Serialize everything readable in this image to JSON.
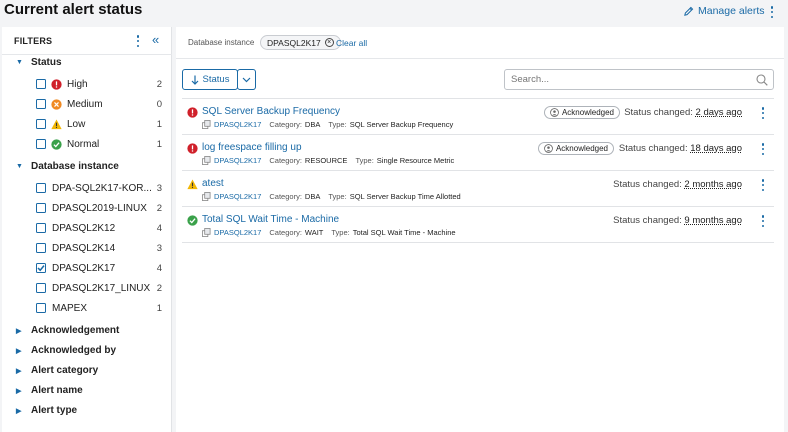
{
  "header": {
    "title": "Current alert status",
    "manage_label": "Manage alerts"
  },
  "sidebar": {
    "filters_label": "FILTERS",
    "status": {
      "title": "Status",
      "items": [
        {
          "label": "High",
          "count": "2",
          "checked": false,
          "icon": "error-icon",
          "color": "#d0202a"
        },
        {
          "label": "Medium",
          "count": "0",
          "checked": false,
          "icon": "warning-circle-icon",
          "color": "#f08a24"
        },
        {
          "label": "Low",
          "count": "1",
          "checked": false,
          "icon": "warning-triangle-icon",
          "color": "#f2b705"
        },
        {
          "label": "Normal",
          "count": "1",
          "checked": false,
          "icon": "check-circle-icon",
          "color": "#3aa14a"
        }
      ]
    },
    "database_instance": {
      "title": "Database instance",
      "items": [
        {
          "label": "DPA-SQL2K17-KOR...",
          "count": "3",
          "checked": false
        },
        {
          "label": "DPASQL2019-LINUX",
          "count": "2",
          "checked": false
        },
        {
          "label": "DPASQL2K12",
          "count": "4",
          "checked": false
        },
        {
          "label": "DPASQL2K14",
          "count": "3",
          "checked": false
        },
        {
          "label": "DPASQL2K17",
          "count": "4",
          "checked": true
        },
        {
          "label": "DPASQL2K17_LINUX",
          "count": "2",
          "checked": false
        },
        {
          "label": "MAPEX",
          "count": "1",
          "checked": false
        }
      ]
    },
    "collapsed_sections": [
      "Acknowledgement",
      "Acknowledged by",
      "Alert category",
      "Alert name",
      "Alert type"
    ]
  },
  "filterbar": {
    "label": "Database instance",
    "chip": "DPASQL2K17",
    "clear_all": "Clear all"
  },
  "toolbar": {
    "status_button": "Status",
    "search_placeholder": "Search..."
  },
  "labels": {
    "category": "Category:",
    "type": "Type:",
    "status_changed": "Status changed:"
  },
  "alerts": [
    {
      "name": "SQL Server Backup Frequency",
      "severity": "error-icon",
      "instance": "DPASQL2K17",
      "category": "DBA",
      "type": "SQL Server Backup Frequency",
      "acknowledged": "Acknowledged",
      "ago": "2 days ago"
    },
    {
      "name": "log freespace filling up",
      "severity": "error-icon",
      "instance": "DPASQL2K17",
      "category": "RESOURCE",
      "type": "Single Resource Metric",
      "acknowledged": "Acknowledged",
      "ago": "18 days ago"
    },
    {
      "name": "atest",
      "severity": "warning-triangle-icon",
      "instance": "DPASQL2K17",
      "category": "DBA",
      "type": "SQL Server Backup Time Allotted",
      "acknowledged": "",
      "ago": "2 months ago"
    },
    {
      "name": "Total SQL Wait Time - Machine",
      "severity": "check-circle-icon",
      "instance": "DPASQL2K17",
      "category": "WAIT",
      "type": "Total SQL Wait Time - Machine",
      "acknowledged": "",
      "ago": "9 months ago"
    }
  ],
  "colors": {
    "accent": "#1a6aa6",
    "high": "#d0202a",
    "medium": "#f08a24",
    "low": "#f2b705",
    "normal": "#3aa14a"
  }
}
